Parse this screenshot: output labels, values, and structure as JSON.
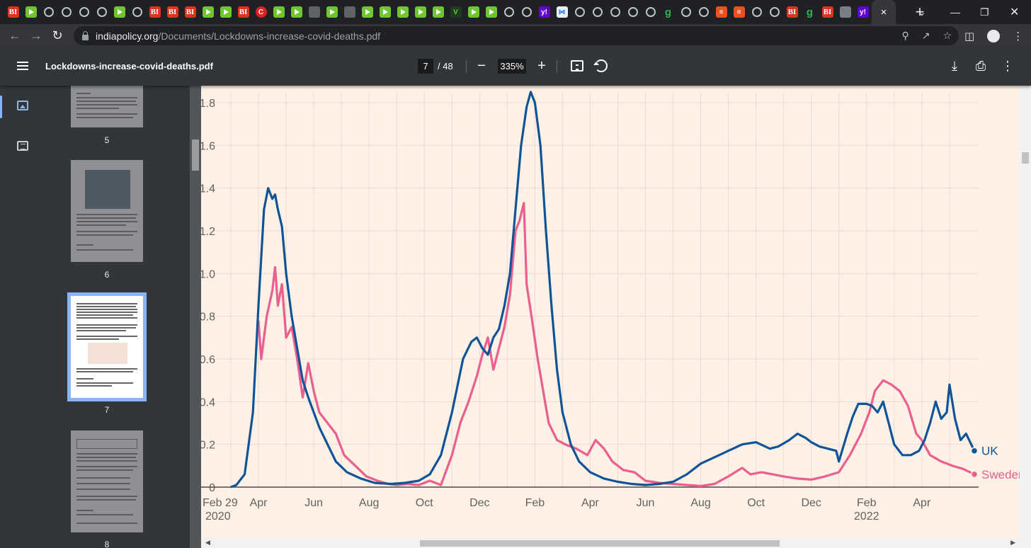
{
  "browser": {
    "tab_favicons": [
      "bi",
      "play",
      "globe",
      "globe",
      "globe",
      "globe",
      "play",
      "globe",
      "bi",
      "bi",
      "bi",
      "play",
      "play",
      "bi",
      "red",
      "play",
      "play",
      "dark",
      "play",
      "dark",
      "play",
      "play",
      "play",
      "play",
      "play",
      "vee",
      "play",
      "play",
      "globe",
      "globe",
      "yh",
      "grid",
      "globe",
      "globe",
      "globe",
      "globe",
      "globe",
      "g",
      "globe",
      "globe",
      "o",
      "o",
      "globe",
      "globe",
      "bi",
      "g",
      "bi",
      "cube",
      "yh"
    ],
    "active_tab_close": "×",
    "new_tab_label": "+",
    "address_host": "indiapolicy.org",
    "address_path": "/Documents/Lockdowns-increase-covid-deaths.pdf"
  },
  "pdf_toolbar": {
    "title": "Lockdowns-increase-covid-deaths.pdf",
    "current_page": "7",
    "page_total": "/ 48",
    "zoom": "335%",
    "zoom_out": "−",
    "zoom_in": "+"
  },
  "sidebar": {
    "thumbnails": [
      {
        "page": "5"
      },
      {
        "page": "6"
      },
      {
        "page": "7",
        "selected": true
      },
      {
        "page": "8"
      }
    ]
  },
  "chart_data": {
    "type": "line",
    "x_ticks": [
      {
        "label": "Feb 29",
        "sub": "2020",
        "month": 0
      },
      {
        "label": "Apr",
        "month": 1
      },
      {
        "label": "Jun",
        "month": 3
      },
      {
        "label": "Aug",
        "month": 5
      },
      {
        "label": "Oct",
        "month": 7
      },
      {
        "label": "Dec",
        "month": 9
      },
      {
        "label": "Feb",
        "month": 11
      },
      {
        "label": "Apr",
        "month": 13
      },
      {
        "label": "Jun",
        "month": 15
      },
      {
        "label": "Aug",
        "month": 17
      },
      {
        "label": "Oct",
        "month": 19
      },
      {
        "label": "Dec",
        "month": 21
      },
      {
        "label": "Feb",
        "sub": "2022",
        "month": 23
      },
      {
        "label": "Apr",
        "month": 25
      }
    ],
    "y_ticks": [
      {
        "label": "0",
        "value": 0
      },
      {
        "label": "0.2",
        "value": 0.2
      },
      {
        "label": "0.4",
        "value": 0.4
      },
      {
        "label": "0.6",
        "value": 0.6
      },
      {
        "label": "0.8",
        "value": 0.8
      },
      {
        "label": "1.0",
        "value": 1.0
      },
      {
        "label": "1.2",
        "value": 1.2
      },
      {
        "label": "1.4",
        "value": 1.4
      },
      {
        "label": "1.6",
        "value": 1.6
      },
      {
        "label": "1.8",
        "value": 1.8
      }
    ],
    "xlim": [
      0,
      26.9
    ],
    "ylim": [
      0,
      1.85
    ],
    "grid": true,
    "legend": "end-of-line labels",
    "series": [
      {
        "name": "UK",
        "color": "#0f5499",
        "points": [
          [
            0,
            0
          ],
          [
            0.2,
            0.01
          ],
          [
            0.5,
            0.06
          ],
          [
            0.8,
            0.35
          ],
          [
            1.0,
            0.85
          ],
          [
            1.2,
            1.3
          ],
          [
            1.35,
            1.4
          ],
          [
            1.5,
            1.35
          ],
          [
            1.6,
            1.37
          ],
          [
            1.7,
            1.3
          ],
          [
            1.85,
            1.22
          ],
          [
            2.0,
            1.0
          ],
          [
            2.2,
            0.8
          ],
          [
            2.4,
            0.65
          ],
          [
            2.6,
            0.5
          ],
          [
            2.8,
            0.42
          ],
          [
            3.0,
            0.35
          ],
          [
            3.2,
            0.28
          ],
          [
            3.5,
            0.2
          ],
          [
            3.8,
            0.12
          ],
          [
            4.2,
            0.07
          ],
          [
            4.7,
            0.04
          ],
          [
            5.2,
            0.02
          ],
          [
            5.8,
            0.015
          ],
          [
            6.3,
            0.02
          ],
          [
            6.8,
            0.03
          ],
          [
            7.2,
            0.06
          ],
          [
            7.6,
            0.15
          ],
          [
            8.0,
            0.35
          ],
          [
            8.4,
            0.6
          ],
          [
            8.7,
            0.68
          ],
          [
            8.9,
            0.7
          ],
          [
            9.1,
            0.65
          ],
          [
            9.3,
            0.62
          ],
          [
            9.5,
            0.7
          ],
          [
            9.7,
            0.74
          ],
          [
            9.9,
            0.85
          ],
          [
            10.1,
            1.0
          ],
          [
            10.3,
            1.3
          ],
          [
            10.5,
            1.6
          ],
          [
            10.7,
            1.78
          ],
          [
            10.85,
            1.85
          ],
          [
            11.0,
            1.8
          ],
          [
            11.2,
            1.6
          ],
          [
            11.4,
            1.2
          ],
          [
            11.6,
            0.85
          ],
          [
            11.8,
            0.55
          ],
          [
            12.0,
            0.35
          ],
          [
            12.3,
            0.2
          ],
          [
            12.6,
            0.12
          ],
          [
            13.0,
            0.07
          ],
          [
            13.5,
            0.04
          ],
          [
            14.0,
            0.025
          ],
          [
            14.5,
            0.015
          ],
          [
            15.0,
            0.01
          ],
          [
            15.5,
            0.015
          ],
          [
            16.0,
            0.025
          ],
          [
            16.5,
            0.06
          ],
          [
            17.0,
            0.11
          ],
          [
            17.5,
            0.14
          ],
          [
            18.0,
            0.17
          ],
          [
            18.5,
            0.2
          ],
          [
            19.0,
            0.21
          ],
          [
            19.5,
            0.18
          ],
          [
            19.8,
            0.19
          ],
          [
            20.2,
            0.22
          ],
          [
            20.5,
            0.25
          ],
          [
            20.8,
            0.23
          ],
          [
            21.0,
            0.21
          ],
          [
            21.3,
            0.19
          ],
          [
            21.6,
            0.18
          ],
          [
            21.9,
            0.17
          ],
          [
            22.0,
            0.12
          ],
          [
            22.3,
            0.25
          ],
          [
            22.5,
            0.33
          ],
          [
            22.7,
            0.39
          ],
          [
            23.0,
            0.39
          ],
          [
            23.2,
            0.38
          ],
          [
            23.4,
            0.35
          ],
          [
            23.6,
            0.4
          ],
          [
            23.8,
            0.3
          ],
          [
            24.0,
            0.2
          ],
          [
            24.3,
            0.15
          ],
          [
            24.6,
            0.15
          ],
          [
            24.9,
            0.17
          ],
          [
            25.1,
            0.22
          ],
          [
            25.3,
            0.3
          ],
          [
            25.5,
            0.4
          ],
          [
            25.7,
            0.32
          ],
          [
            25.9,
            0.35
          ],
          [
            26.0,
            0.48
          ],
          [
            26.2,
            0.32
          ],
          [
            26.4,
            0.22
          ],
          [
            26.6,
            0.25
          ],
          [
            26.9,
            0.17
          ]
        ]
      },
      {
        "name": "Sweden",
        "color": "#eb5e8d",
        "points": [
          [
            1.0,
            0.78
          ],
          [
            1.1,
            0.6
          ],
          [
            1.3,
            0.8
          ],
          [
            1.5,
            0.92
          ],
          [
            1.6,
            1.03
          ],
          [
            1.7,
            0.85
          ],
          [
            1.85,
            0.95
          ],
          [
            2.0,
            0.7
          ],
          [
            2.2,
            0.75
          ],
          [
            2.4,
            0.6
          ],
          [
            2.6,
            0.42
          ],
          [
            2.8,
            0.58
          ],
          [
            3.0,
            0.45
          ],
          [
            3.2,
            0.35
          ],
          [
            3.5,
            0.3
          ],
          [
            3.8,
            0.25
          ],
          [
            4.1,
            0.15
          ],
          [
            4.5,
            0.1
          ],
          [
            4.9,
            0.05
          ],
          [
            5.3,
            0.03
          ],
          [
            5.7,
            0.015
          ],
          [
            6.0,
            0.01
          ],
          [
            6.4,
            0.015
          ],
          [
            6.8,
            0.01
          ],
          [
            7.2,
            0.03
          ],
          [
            7.6,
            0.01
          ],
          [
            8.0,
            0.15
          ],
          [
            8.3,
            0.3
          ],
          [
            8.6,
            0.4
          ],
          [
            8.9,
            0.52
          ],
          [
            9.1,
            0.62
          ],
          [
            9.3,
            0.7
          ],
          [
            9.5,
            0.55
          ],
          [
            9.7,
            0.65
          ],
          [
            9.9,
            0.75
          ],
          [
            10.1,
            0.9
          ],
          [
            10.3,
            1.2
          ],
          [
            10.45,
            1.25
          ],
          [
            10.6,
            1.33
          ],
          [
            10.7,
            0.95
          ],
          [
            10.9,
            0.78
          ],
          [
            11.1,
            0.6
          ],
          [
            11.3,
            0.45
          ],
          [
            11.5,
            0.3
          ],
          [
            11.8,
            0.22
          ],
          [
            12.1,
            0.2
          ],
          [
            12.5,
            0.18
          ],
          [
            12.9,
            0.15
          ],
          [
            13.2,
            0.22
          ],
          [
            13.5,
            0.18
          ],
          [
            13.8,
            0.12
          ],
          [
            14.2,
            0.08
          ],
          [
            14.6,
            0.07
          ],
          [
            15.0,
            0.03
          ],
          [
            15.5,
            0.02
          ],
          [
            16.0,
            0.015
          ],
          [
            16.5,
            0.01
          ],
          [
            17.0,
            0.005
          ],
          [
            17.5,
            0.015
          ],
          [
            18.0,
            0.05
          ],
          [
            18.5,
            0.09
          ],
          [
            18.8,
            0.06
          ],
          [
            19.2,
            0.07
          ],
          [
            19.6,
            0.06
          ],
          [
            20.0,
            0.05
          ],
          [
            20.5,
            0.04
          ],
          [
            21.0,
            0.035
          ],
          [
            21.5,
            0.05
          ],
          [
            22.0,
            0.07
          ],
          [
            22.4,
            0.15
          ],
          [
            22.8,
            0.25
          ],
          [
            23.1,
            0.35
          ],
          [
            23.3,
            0.45
          ],
          [
            23.6,
            0.5
          ],
          [
            23.9,
            0.48
          ],
          [
            24.2,
            0.45
          ],
          [
            24.5,
            0.38
          ],
          [
            24.8,
            0.25
          ],
          [
            25.0,
            0.22
          ],
          [
            25.3,
            0.15
          ],
          [
            25.7,
            0.12
          ],
          [
            26.1,
            0.1
          ],
          [
            26.5,
            0.085
          ],
          [
            26.9,
            0.06
          ]
        ]
      }
    ]
  }
}
